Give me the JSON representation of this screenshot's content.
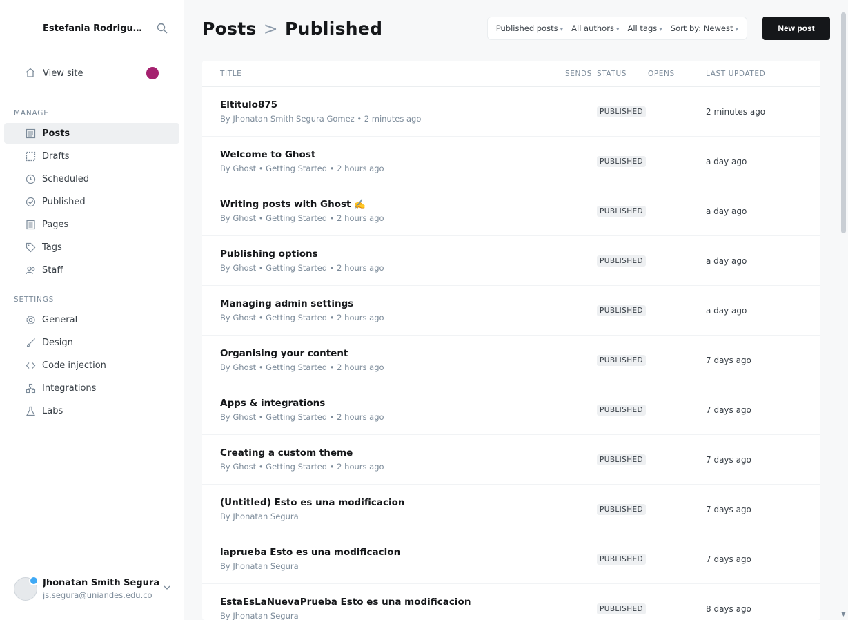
{
  "sidebar": {
    "brand_title": "Estefania Rodriguez Ghost",
    "view_site": "View site",
    "manage_label": "MANAGE",
    "settings_label": "SETTINGS",
    "manage_items": [
      {
        "label": "Posts",
        "icon": "posts-icon"
      },
      {
        "label": "Drafts",
        "icon": "drafts-icon"
      },
      {
        "label": "Scheduled",
        "icon": "scheduled-icon"
      },
      {
        "label": "Published",
        "icon": "published-icon"
      },
      {
        "label": "Pages",
        "icon": "pages-icon"
      },
      {
        "label": "Tags",
        "icon": "tag-icon"
      },
      {
        "label": "Staff",
        "icon": "staff-icon"
      }
    ],
    "settings_items": [
      {
        "label": "General",
        "icon": "gear-icon"
      },
      {
        "label": "Design",
        "icon": "brush-icon"
      },
      {
        "label": "Code injection",
        "icon": "code-icon"
      },
      {
        "label": "Integrations",
        "icon": "integrations-icon"
      },
      {
        "label": "Labs",
        "icon": "flask-icon"
      }
    ],
    "user": {
      "name": "Jhonatan Smith Segura",
      "email": "js.segura@uniandes.edu.co"
    }
  },
  "header": {
    "title": "Posts",
    "separator": ">",
    "subtitle": "Published",
    "filters": [
      "Published posts",
      "All authors",
      "All tags",
      "Sort by: Newest"
    ],
    "new_post": "New post"
  },
  "table": {
    "columns": [
      "TITLE",
      "SENDS",
      "STATUS",
      "OPENS",
      "LAST UPDATED"
    ],
    "rows": [
      {
        "title": "Eltitulo875",
        "meta": "By Jhonatan Smith Segura Gomez • 2 minutes ago",
        "status": "PUBLISHED",
        "updated": "2 minutes ago"
      },
      {
        "title": "Welcome to Ghost",
        "meta": "By Ghost • Getting Started • 2 hours ago",
        "status": "PUBLISHED",
        "updated": "a day ago"
      },
      {
        "title": "Writing posts with Ghost ✍️",
        "meta": "By Ghost • Getting Started • 2 hours ago",
        "status": "PUBLISHED",
        "updated": "a day ago"
      },
      {
        "title": "Publishing options",
        "meta": "By Ghost • Getting Started • 2 hours ago",
        "status": "PUBLISHED",
        "updated": "a day ago"
      },
      {
        "title": "Managing admin settings",
        "meta": "By Ghost • Getting Started • 2 hours ago",
        "status": "PUBLISHED",
        "updated": "a day ago"
      },
      {
        "title": "Organising your content",
        "meta": "By Ghost • Getting Started • 2 hours ago",
        "status": "PUBLISHED",
        "updated": "7 days ago"
      },
      {
        "title": "Apps & integrations",
        "meta": "By Ghost • Getting Started • 2 hours ago",
        "status": "PUBLISHED",
        "updated": "7 days ago"
      },
      {
        "title": "Creating a custom theme",
        "meta": "By Ghost • Getting Started • 2 hours ago",
        "status": "PUBLISHED",
        "updated": "7 days ago"
      },
      {
        "title": "(Untitled) Esto es una modificacion",
        "meta": "By Jhonatan Segura",
        "status": "PUBLISHED",
        "updated": "7 days ago"
      },
      {
        "title": "laprueba Esto es una modificacion",
        "meta": "By Jhonatan Segura",
        "status": "PUBLISHED",
        "updated": "7 days ago"
      },
      {
        "title": "EstaEsLaNuevaPrueba Esto es una modificacion",
        "meta": "By Jhonatan Segura",
        "status": "PUBLISHED",
        "updated": "8 days ago"
      }
    ]
  }
}
